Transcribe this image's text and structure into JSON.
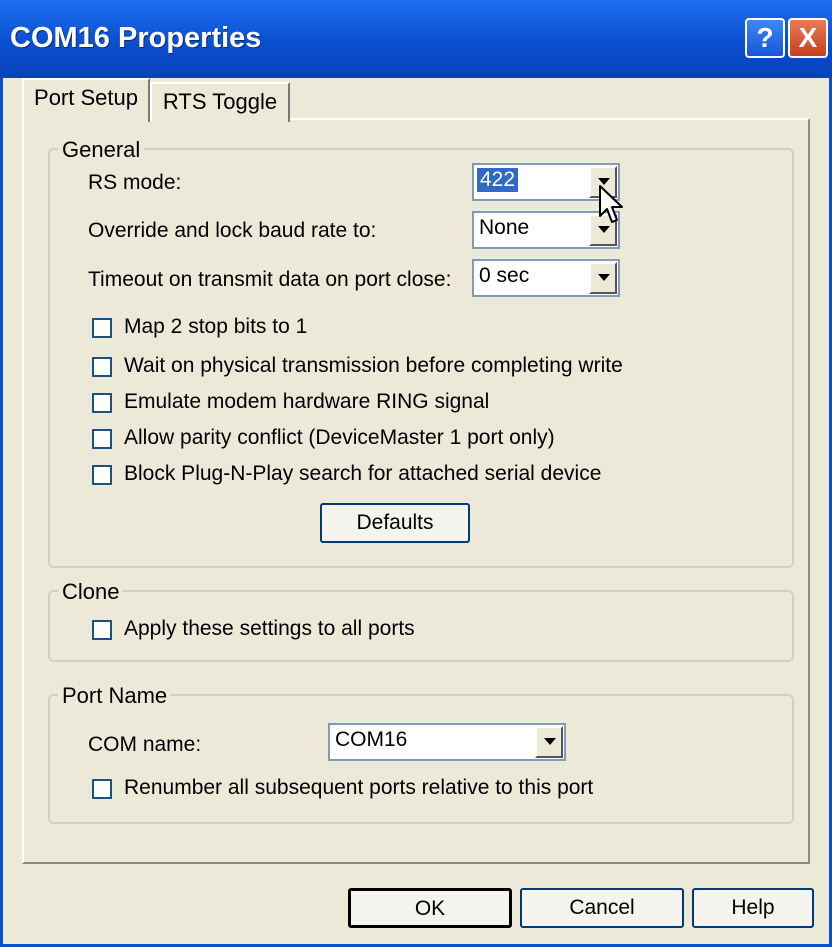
{
  "window": {
    "title": "COM16 Properties",
    "help_glyph": "?",
    "close_glyph": "X",
    "accent": "#0a4fd0"
  },
  "tabs": [
    {
      "label": "Port Setup",
      "active": true
    },
    {
      "label": "RTS Toggle",
      "active": false
    }
  ],
  "general": {
    "title": "General",
    "rs_mode": {
      "label": "RS mode:",
      "value": "422"
    },
    "baud": {
      "label": "Override and lock baud rate to:",
      "value": "None"
    },
    "timeout": {
      "label": "Timeout on transmit data on port close:",
      "value": "0 sec"
    },
    "options": [
      {
        "label": "Map 2 stop bits to 1",
        "checked": false
      },
      {
        "label": "Wait on physical transmission before completing write",
        "checked": false
      },
      {
        "label": "Emulate modem hardware RING signal",
        "checked": false
      },
      {
        "label": "Allow parity conflict (DeviceMaster 1 port only)",
        "checked": false
      },
      {
        "label": "Block Plug-N-Play search for attached serial device",
        "checked": false
      }
    ],
    "defaults_button": "Defaults"
  },
  "clone": {
    "title": "Clone",
    "apply_all": {
      "label": "Apply these settings to all ports",
      "checked": false
    }
  },
  "port_name": {
    "title": "Port Name",
    "com_name": {
      "label": "COM name:",
      "value": "COM16"
    },
    "renumber": {
      "label": "Renumber all subsequent ports relative to this port",
      "checked": false
    }
  },
  "buttons": {
    "ok": "OK",
    "cancel": "Cancel",
    "help": "Help"
  }
}
